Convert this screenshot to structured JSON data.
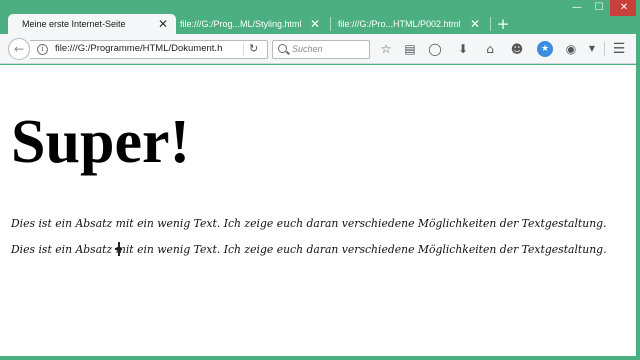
{
  "browser": {
    "tabs": [
      {
        "label": "Meine erste Internet-Seite",
        "active": true
      },
      {
        "label": "file:///G:/Prog...ML/Styling.html",
        "active": false
      },
      {
        "label": "file:///G:/Pro...HTML/P002.html",
        "active": false
      }
    ],
    "new_tab_symbol": "+",
    "window_controls": {
      "minimize": "—",
      "maximize": "☐",
      "close": "✕"
    },
    "close_tab_symbol": "✕",
    "accent_color": "#4caf82"
  },
  "navbar": {
    "url": "file:///G:/Programme/HTML/Dokument.h",
    "search_placeholder": "Suchen",
    "icons": [
      "back-icon",
      "info-icon",
      "reload-icon",
      "search-icon",
      "bookmark-star-icon",
      "reader-list-icon",
      "pocket-icon",
      "download-icon",
      "home-icon",
      "smiley-icon",
      "sync-icon",
      "extension-icon",
      "menu-arrow-icon",
      "hamburger-menu-icon"
    ]
  },
  "page": {
    "heading": "Super!",
    "paragraphs": [
      "Dies ist ein Absatz mit ein wenig Text. Ich zeige euch daran verschiedene Möglichkeiten der Textgestaltung.",
      "Dies ist ein Absatz mit ein wenig Text. Ich zeige euch daran verschiedene Möglichkeiten der Textgestaltung."
    ]
  }
}
